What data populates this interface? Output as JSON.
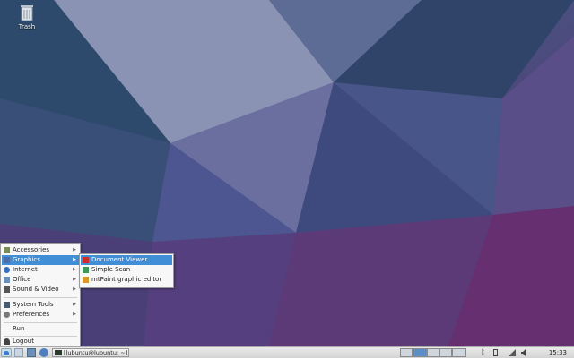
{
  "desktop": {
    "icons": [
      {
        "label": "Trash",
        "icon": "trash-icon"
      }
    ]
  },
  "main_menu": {
    "items": [
      {
        "label": "Accessories",
        "icon": "accessories-icon",
        "submenu": true
      },
      {
        "label": "Graphics",
        "icon": "graphics-icon",
        "submenu": true,
        "selected": true
      },
      {
        "label": "Internet",
        "icon": "internet-icon",
        "submenu": true
      },
      {
        "label": "Office",
        "icon": "office-icon",
        "submenu": true
      },
      {
        "label": "Sound & Video",
        "icon": "sound-video-icon",
        "submenu": true
      },
      {
        "label": "System Tools",
        "icon": "system-tools-icon",
        "submenu": true
      },
      {
        "label": "Preferences",
        "icon": "preferences-icon",
        "submenu": true
      },
      {
        "label": "Run",
        "icon": "",
        "submenu": false
      },
      {
        "label": "Logout",
        "icon": "logout-icon",
        "submenu": false
      }
    ]
  },
  "graphics_submenu": {
    "items": [
      {
        "label": "Document Viewer",
        "icon": "document-viewer-icon",
        "selected": true
      },
      {
        "label": "Simple Scan",
        "icon": "scanner-icon"
      },
      {
        "label": "mtPaint graphic editor",
        "icon": "paint-icon"
      }
    ]
  },
  "taskbar": {
    "task_title": "[lubuntu@lubuntu: ~]",
    "clock": "15:33",
    "workspaces": 4,
    "active_workspace": 1
  },
  "colors": {
    "menu_highlight": "#3f8ed6",
    "wallpaper_top": "#3c4f78",
    "wallpaper_bottom": "#5a2f6a"
  }
}
